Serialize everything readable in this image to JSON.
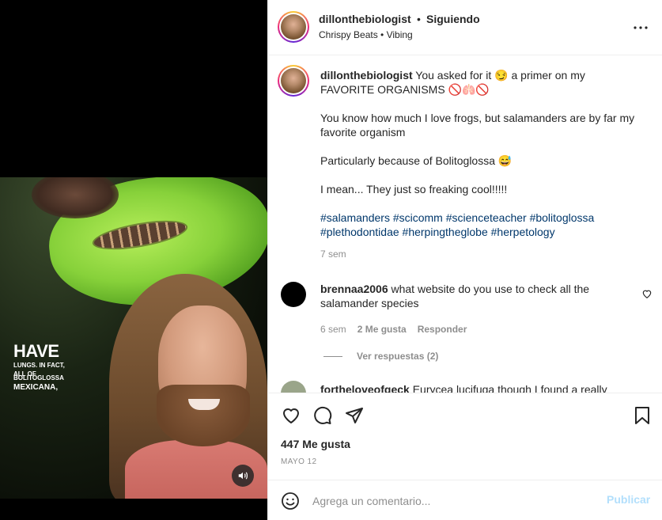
{
  "video": {
    "overlay_big_1": "HAVE",
    "overlay_small_1": "LUNGS. IN FACT,",
    "overlay_small_2": "ALL OF",
    "overlay_small_3": "BOLITOGLOSSA",
    "overlay_mid": "MEXICANA,"
  },
  "header": {
    "username": "dillonthebiologist",
    "separator": "•",
    "follow_status": "Siguiendo",
    "audio": "Chrispy Beats • Vibing"
  },
  "caption": {
    "username": "dillonthebiologist",
    "line1": "You asked for it 😏 a primer on my FAVORITE ORGANISMS 🚫🫁🚫",
    "line2": "You know how much I love frogs, but salamanders are by far my favorite organism",
    "line3": "Particularly because of Bolitoglossa 😅",
    "line4": "I mean... They just so freaking cool!!!!!",
    "hashtags": "#salamanders #scicomm #scienceteacher #bolitoglossa #plethodontidae #herpingtheglobe #herpetology",
    "time": "7 sem"
  },
  "comments": [
    {
      "username": "brennaa2006",
      "text": "what website do you use to check all the salamander species",
      "time": "6 sem",
      "likes": "2 Me gusta",
      "reply": "Responder",
      "view_replies": "Ver respuestas (2)"
    },
    {
      "username": "fortheloveofgeck",
      "text": "Eurycea lucifuga though I found a really"
    }
  ],
  "actions": {
    "likes": "447 Me gusta",
    "date": "MAYO 12"
  },
  "add_comment": {
    "placeholder": "Agrega un comentario...",
    "publish": "Publicar"
  }
}
